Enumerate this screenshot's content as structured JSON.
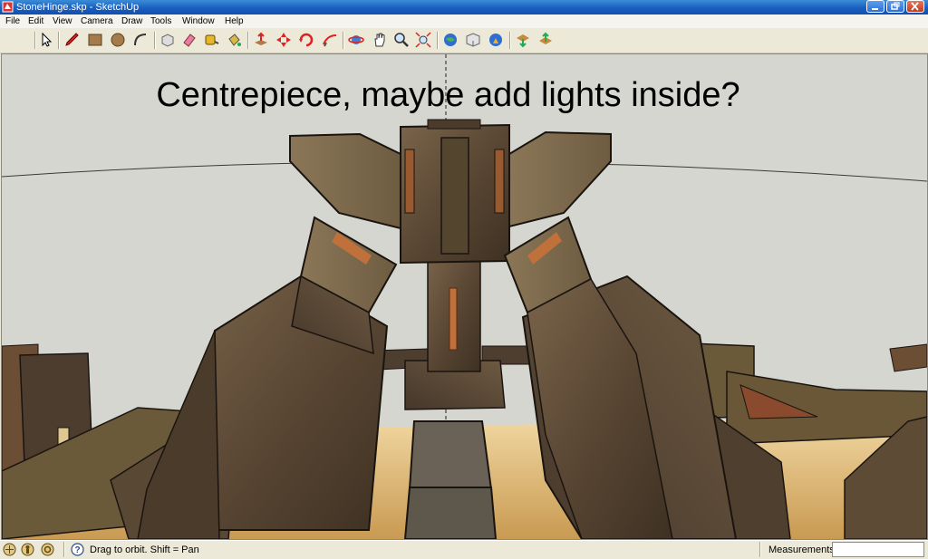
{
  "window": {
    "title": "StoneHinge.skp - SketchUp"
  },
  "menu": [
    "File",
    "Edit",
    "View",
    "Camera",
    "Draw",
    "Tools",
    "Window",
    "Help"
  ],
  "toolbar": [
    {
      "name": "select-tool-icon"
    },
    {
      "name": "pencil-tool-icon"
    },
    {
      "name": "rectangle-tool-icon"
    },
    {
      "name": "circle-tool-icon"
    },
    {
      "name": "arc-tool-icon"
    },
    {
      "name": "make-component-icon"
    },
    {
      "name": "eraser-tool-icon"
    },
    {
      "name": "tape-measure-icon"
    },
    {
      "name": "paint-bucket-icon"
    },
    {
      "name": "push-pull-icon"
    },
    {
      "name": "move-tool-icon"
    },
    {
      "name": "rotate-tool-icon"
    },
    {
      "name": "follow-me-icon"
    },
    {
      "name": "orbit-tool-icon"
    },
    {
      "name": "pan-tool-icon"
    },
    {
      "name": "zoom-tool-icon"
    },
    {
      "name": "zoom-extents-icon"
    },
    {
      "name": "get-models-icon"
    },
    {
      "name": "share-model-icon"
    },
    {
      "name": "google-earth-icon"
    },
    {
      "name": "get-component-icon"
    },
    {
      "name": "share-component-icon"
    }
  ],
  "viewport": {
    "caption": "Centrepiece, maybe add lights inside?"
  },
  "status": {
    "hint": "Drag to orbit.  Shift = Pan",
    "measurements_label": "Measurements",
    "measurements_value": ""
  },
  "colors": {
    "sky": "#d6d6d0",
    "ground": "#e8c98a",
    "stone": "#5c4a36",
    "accent": "#c0703a"
  }
}
